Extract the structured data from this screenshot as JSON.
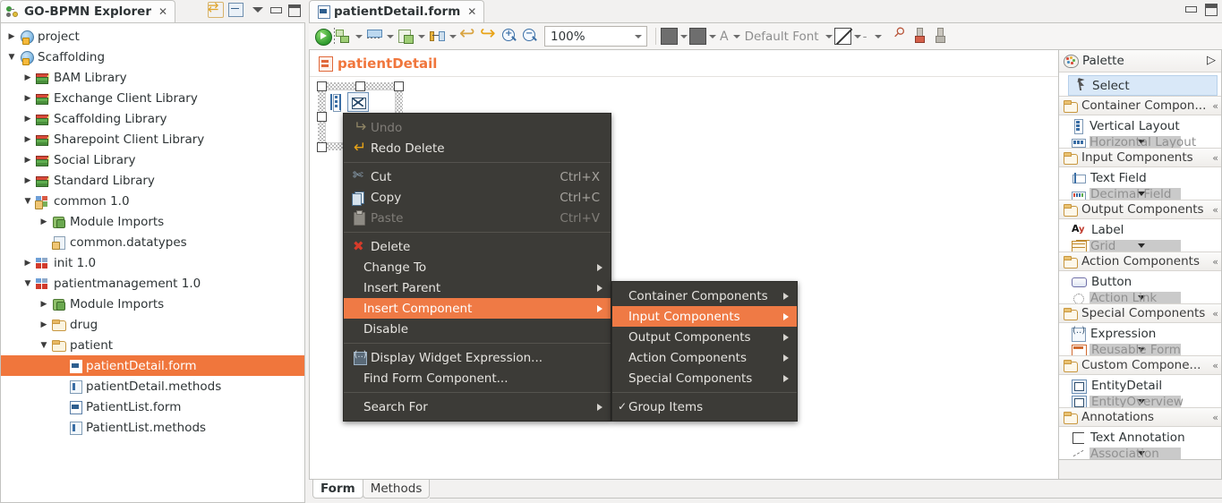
{
  "explorer": {
    "tab_title": "GO-BPMN Explorer",
    "close_glyph": "✕",
    "toolbar_icons": [
      "link-with-editor-icon",
      "collapse-all-icon",
      "view-menu-icon",
      "minimize-icon",
      "maximize-icon"
    ],
    "tree": [
      {
        "label": "project",
        "depth": 0,
        "twisty": "collapsed",
        "icon": "project-icon",
        "selected": false
      },
      {
        "label": "Scaffolding",
        "depth": 0,
        "twisty": "expanded",
        "icon": "project-icon",
        "selected": false
      },
      {
        "label": "BAM Library",
        "depth": 1,
        "twisty": "collapsed",
        "icon": "library-icon",
        "selected": false
      },
      {
        "label": "Exchange Client Library",
        "depth": 1,
        "twisty": "collapsed",
        "icon": "library-icon",
        "selected": false
      },
      {
        "label": "Scaffolding Library",
        "depth": 1,
        "twisty": "collapsed",
        "icon": "library-icon",
        "selected": false
      },
      {
        "label": "Sharepoint Client Library",
        "depth": 1,
        "twisty": "collapsed",
        "icon": "library-icon",
        "selected": false
      },
      {
        "label": "Social Library",
        "depth": 1,
        "twisty": "collapsed",
        "icon": "library-icon",
        "selected": false
      },
      {
        "label": "Standard Library",
        "depth": 1,
        "twisty": "collapsed",
        "icon": "library-icon",
        "selected": false
      },
      {
        "label": "common 1.0",
        "depth": 1,
        "twisty": "expanded",
        "icon": "module-icon",
        "selected": false
      },
      {
        "label": "Module Imports",
        "depth": 2,
        "twisty": "collapsed",
        "icon": "module-imports-icon",
        "selected": false
      },
      {
        "label": "common.datatypes",
        "depth": 2,
        "twisty": "none",
        "icon": "datatypes-icon",
        "selected": false
      },
      {
        "label": "init 1.0",
        "depth": 1,
        "twisty": "collapsed",
        "icon": "module-red-icon",
        "selected": false
      },
      {
        "label": "patientmanagement 1.0",
        "depth": 1,
        "twisty": "expanded",
        "icon": "module-red-icon",
        "selected": false
      },
      {
        "label": "Module Imports",
        "depth": 2,
        "twisty": "collapsed",
        "icon": "module-imports-icon",
        "selected": false
      },
      {
        "label": "drug",
        "depth": 2,
        "twisty": "collapsed",
        "icon": "folder-icon",
        "selected": false
      },
      {
        "label": "patient",
        "depth": 2,
        "twisty": "expanded",
        "icon": "folder-icon",
        "selected": false
      },
      {
        "label": "patientDetail.form",
        "depth": 3,
        "twisty": "none",
        "icon": "form-file-icon",
        "selected": true
      },
      {
        "label": "patientDetail.methods",
        "depth": 3,
        "twisty": "none",
        "icon": "methods-file-icon",
        "selected": false
      },
      {
        "label": "PatientList.form",
        "depth": 3,
        "twisty": "none",
        "icon": "form-file-icon",
        "selected": false
      },
      {
        "label": "PatientList.methods",
        "depth": 3,
        "twisty": "none",
        "icon": "methods-file-icon",
        "selected": false
      }
    ]
  },
  "editor": {
    "tab_title": "patientDetail.form",
    "close_glyph": "✕",
    "window_icons": [
      "minimize-icon",
      "maximize-icon"
    ],
    "toolbar": {
      "zoom_value": "100%",
      "font_name": "Default Font",
      "letter_glyph": "A",
      "line_style_label": "-",
      "buttons": [
        "run-icon",
        "align-left-icon",
        "match-size-icon",
        "new-component-icon",
        "distribute-icon",
        "undo-icon",
        "redo-icon",
        "zoom-in-icon",
        "zoom-out-icon",
        "fill-color-icon",
        "line-color-icon",
        "font-color-icon",
        "color-picker-icon",
        "paint-brush-icon",
        "paint-brush-gray-icon"
      ]
    },
    "form_title": "patientDetail",
    "bottom_tabs": [
      {
        "label": "Form",
        "active": true
      },
      {
        "label": "Methods",
        "active": false
      }
    ]
  },
  "context_menu": {
    "items": [
      {
        "label": "Undo",
        "icon": "undo-icon",
        "accel": "",
        "state": "disabled",
        "submenu": false
      },
      {
        "label": "Redo Delete",
        "icon": "redo-icon",
        "accel": "",
        "state": "normal",
        "submenu": false
      },
      {
        "separator": true
      },
      {
        "label": "Cut",
        "icon": "cut-icon",
        "accel": "Ctrl+X",
        "state": "normal",
        "submenu": false
      },
      {
        "label": "Copy",
        "icon": "copy-icon",
        "accel": "Ctrl+C",
        "state": "normal",
        "submenu": false
      },
      {
        "label": "Paste",
        "icon": "paste-icon",
        "accel": "Ctrl+V",
        "state": "disabled",
        "submenu": false
      },
      {
        "separator": true
      },
      {
        "label": "Delete",
        "icon": "delete-icon",
        "accel": "",
        "state": "normal",
        "submenu": false
      },
      {
        "label": "Change To",
        "icon": "",
        "accel": "",
        "state": "normal",
        "submenu": true
      },
      {
        "label": "Insert Parent",
        "icon": "",
        "accel": "",
        "state": "normal",
        "submenu": true
      },
      {
        "label": "Insert Component",
        "icon": "",
        "accel": "",
        "state": "highlighted",
        "submenu": true
      },
      {
        "label": "Disable",
        "icon": "",
        "accel": "",
        "state": "normal",
        "submenu": false
      },
      {
        "separator": true
      },
      {
        "label": "Display Widget Expression...",
        "icon": "expression-icon",
        "accel": "",
        "state": "normal",
        "submenu": false
      },
      {
        "label": "Find Form Component...",
        "icon": "",
        "accel": "",
        "state": "normal",
        "submenu": false
      },
      {
        "separator": true
      },
      {
        "label": "Search For",
        "icon": "",
        "accel": "",
        "state": "normal",
        "submenu": true
      }
    ],
    "submenu": {
      "items": [
        {
          "label": "Container Components",
          "state": "normal",
          "submenu": true,
          "checked": false
        },
        {
          "label": "Input Components",
          "state": "highlighted",
          "submenu": true,
          "checked": false
        },
        {
          "label": "Output Components",
          "state": "normal",
          "submenu": true,
          "checked": false
        },
        {
          "label": "Action Components",
          "state": "normal",
          "submenu": true,
          "checked": false
        },
        {
          "label": "Special Components",
          "state": "normal",
          "submenu": true,
          "checked": false
        },
        {
          "separator": true
        },
        {
          "label": "Group Items",
          "state": "normal",
          "submenu": false,
          "checked": true,
          "check_glyph": "✓"
        }
      ]
    }
  },
  "palette": {
    "title": "Palette",
    "pin_icon": "next-arrow-icon",
    "select_label": "Select",
    "select_icon": "cursor-icon",
    "groups": [
      {
        "name": "Container Compon...",
        "icon": "folder-icon",
        "chevron": "«",
        "items": [
          {
            "label": "Vertical Layout",
            "icon": "vertical-layout-icon",
            "cut": false
          },
          {
            "label": "Horizontal Layout",
            "icon": "horizontal-layout-icon",
            "cut": true
          }
        ]
      },
      {
        "name": "Input Components",
        "icon": "folder-icon",
        "chevron": "«",
        "items": [
          {
            "label": "Text Field",
            "icon": "text-field-icon",
            "cut": false
          },
          {
            "label": "Decimal Field",
            "icon": "decimal-field-icon",
            "cut": true
          }
        ]
      },
      {
        "name": "Output Components",
        "icon": "folder-icon",
        "chevron": "«",
        "items": [
          {
            "label": "Label",
            "icon": "label-icon",
            "cut": false
          },
          {
            "label": "Grid",
            "icon": "grid-icon",
            "cut": true
          }
        ]
      },
      {
        "name": "Action Components",
        "icon": "folder-icon",
        "chevron": "«",
        "items": [
          {
            "label": "Button",
            "icon": "button-icon",
            "cut": false
          },
          {
            "label": "Action Link",
            "icon": "action-link-icon",
            "cut": true
          }
        ]
      },
      {
        "name": "Special Components",
        "icon": "folder-icon",
        "chevron": "«",
        "items": [
          {
            "label": "Expression",
            "icon": "expression-icon",
            "cut": false
          },
          {
            "label": "Reusable Form",
            "icon": "reusable-form-icon",
            "cut": true
          }
        ]
      },
      {
        "name": "Custom Compone...",
        "icon": "folder-icon",
        "chevron": "«",
        "items": [
          {
            "label": "EntityDetail",
            "icon": "entity-icon",
            "cut": false
          },
          {
            "label": "EntityOverview",
            "icon": "entity-icon",
            "cut": true
          }
        ]
      },
      {
        "name": "Annotations",
        "icon": "folder-icon",
        "chevron": "«",
        "items": [
          {
            "label": "Text Annotation",
            "icon": "text-annotation-icon",
            "cut": false
          },
          {
            "label": "Association",
            "icon": "association-icon",
            "cut": true
          }
        ]
      }
    ]
  },
  "colors": {
    "accent_orange": "#ef7a45",
    "selection_orange": "#f0763c",
    "menu_bg": "#3c3b37",
    "palette_select_blue": "#d9e8f8"
  }
}
